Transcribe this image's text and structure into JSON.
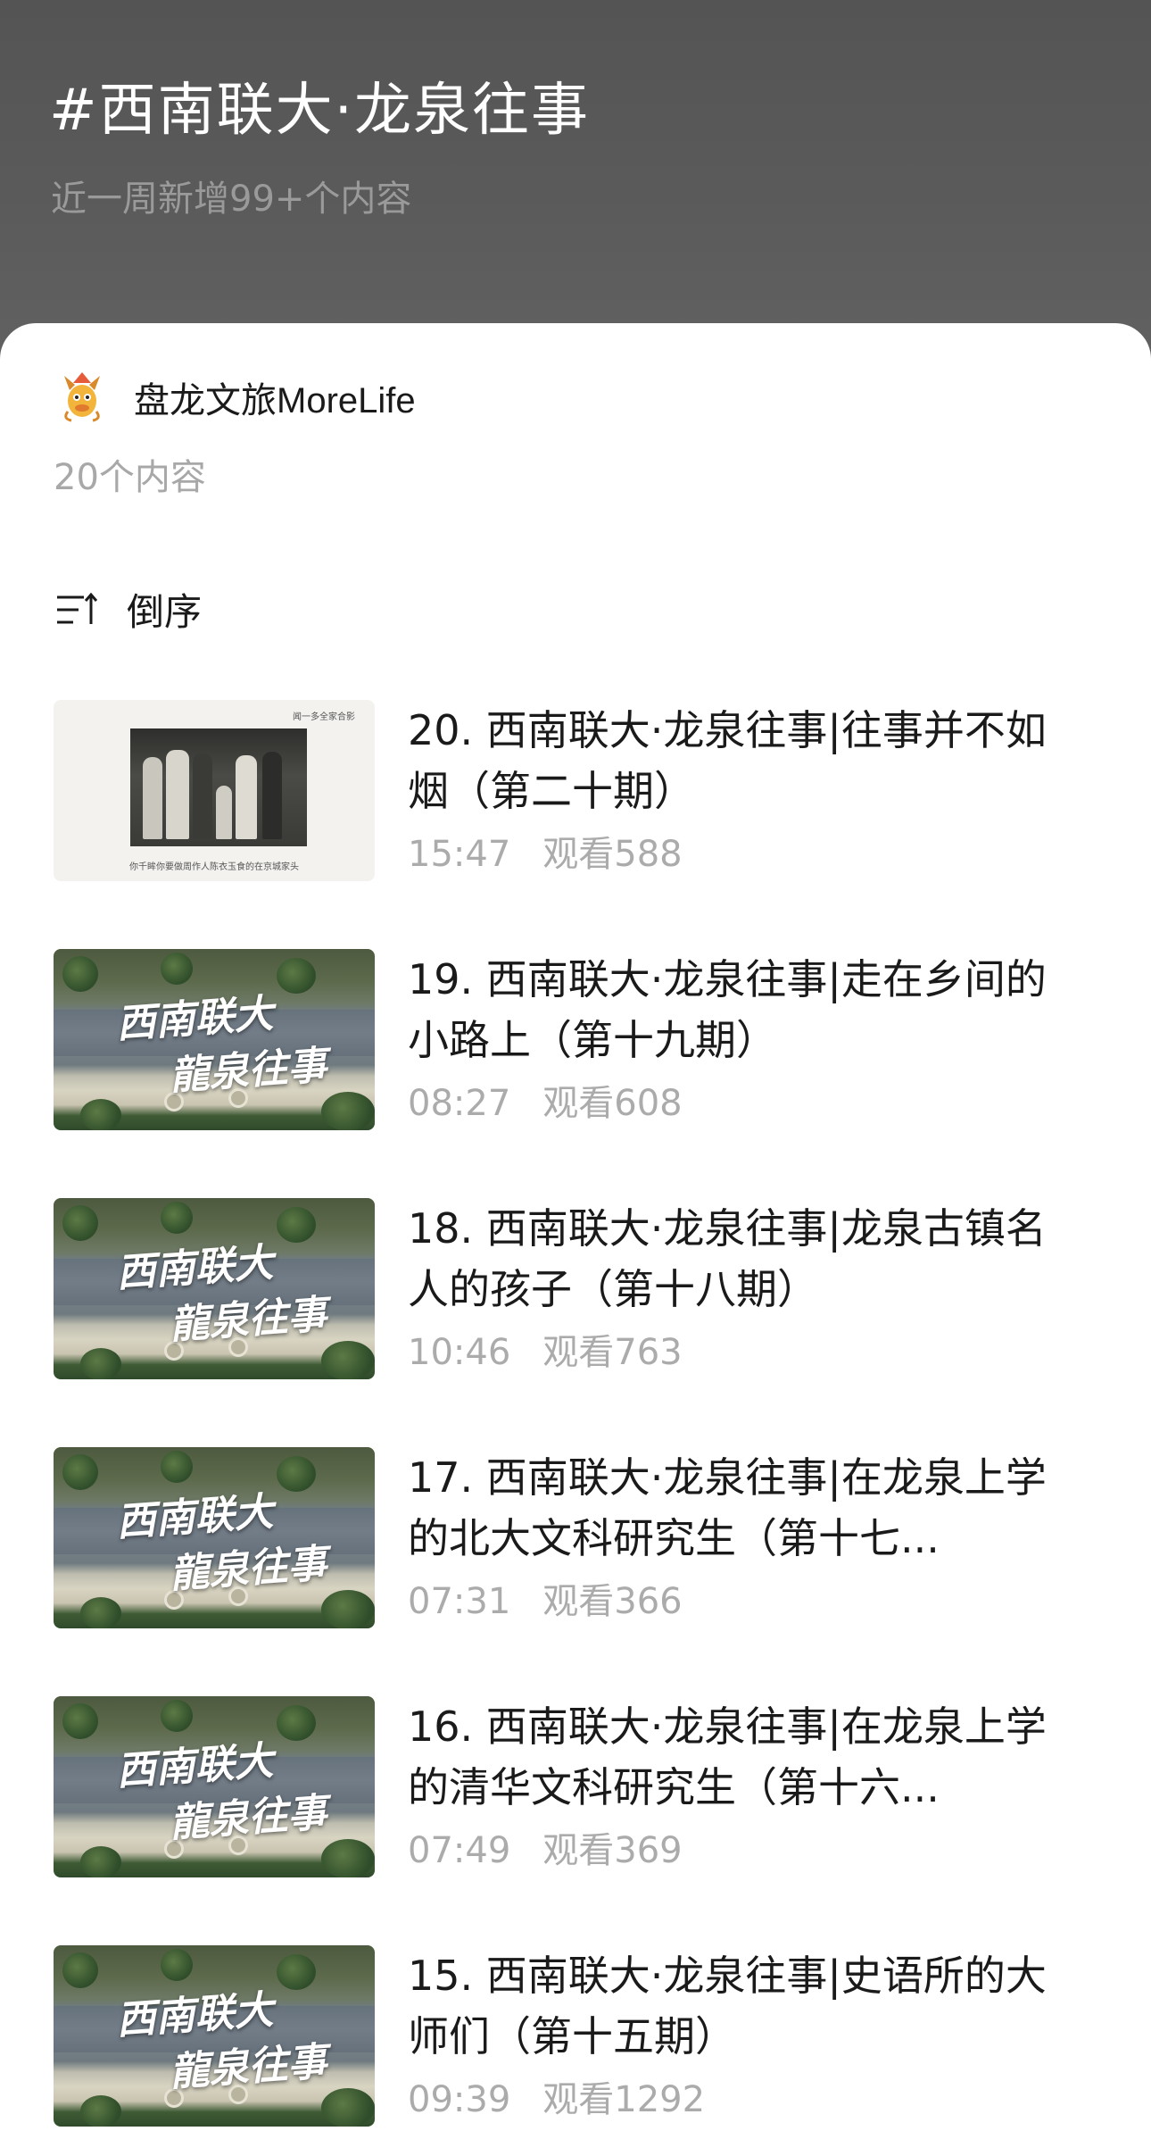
{
  "header": {
    "topic_title": "#西南联大·龙泉往事",
    "topic_subtitle": "近一周新增99+个内容"
  },
  "creator": {
    "name": "盘龙文旅MoreLife",
    "avatar_icon": "dragon-mascot-avatar",
    "content_count": "20个内容"
  },
  "sort": {
    "icon": "sort-descending-icon",
    "label": "倒序"
  },
  "items": [
    {
      "title": "20. 西南联大·龙泉往事|往事并不如烟（第二十期）",
      "duration": "15:47",
      "views": "观看588",
      "thumb": "photo",
      "thumb_caption_top": "闻一多全家合影",
      "thumb_caption_bottom": "你千眸你要做周作人陈衣玉食的在京城家头"
    },
    {
      "title": "19. 西南联大·龙泉往事|走在乡间的小路上（第十九期）",
      "duration": "08:27",
      "views": "观看608",
      "thumb": "aerial",
      "thumb_text_1": "西南联大",
      "thumb_text_2": "龍泉往事"
    },
    {
      "title": "18. 西南联大·龙泉往事|龙泉古镇名人的孩子（第十八期）",
      "duration": "10:46",
      "views": "观看763",
      "thumb": "aerial",
      "thumb_text_1": "西南联大",
      "thumb_text_2": "龍泉往事"
    },
    {
      "title": "17. 西南联大·龙泉往事|在龙泉上学的北大文科研究生（第十七...",
      "duration": "07:31",
      "views": "观看366",
      "thumb": "aerial",
      "thumb_text_1": "西南联大",
      "thumb_text_2": "龍泉往事"
    },
    {
      "title": "16. 西南联大·龙泉往事|在龙泉上学的清华文科研究生（第十六...",
      "duration": "07:49",
      "views": "观看369",
      "thumb": "aerial",
      "thumb_text_1": "西南联大",
      "thumb_text_2": "龍泉往事"
    },
    {
      "title": "15. 西南联大·龙泉往事|史语所的大师们（第十五期）",
      "duration": "09:39",
      "views": "观看1292",
      "thumb": "aerial",
      "thumb_text_1": "西南联大",
      "thumb_text_2": "龍泉往事"
    }
  ],
  "colors": {
    "header_bg": "#5b5b5b",
    "title_text": "#ffffff",
    "subtitle_text": "#9a9a9a",
    "sheet_bg": "#ffffff",
    "primary_text": "#1a1a1a",
    "secondary_text": "#ababab"
  }
}
